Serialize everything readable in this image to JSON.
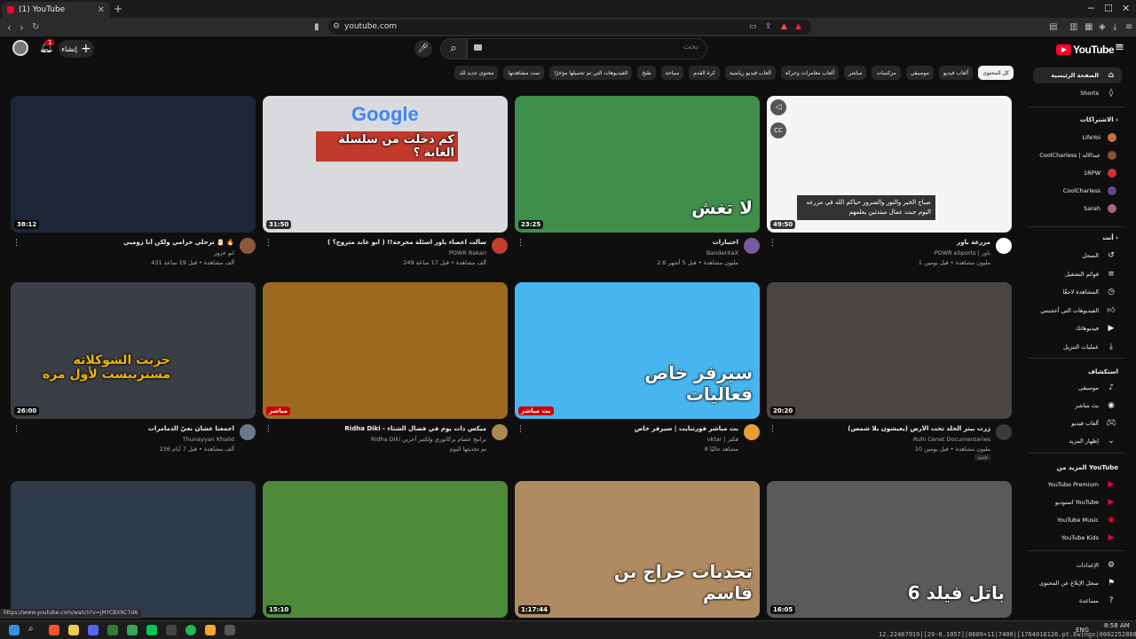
{
  "browser": {
    "tab_title": "(1) YouTube",
    "url": "youtube.com",
    "status_url": "https://www.youtube.com/watch?v=jMYCBXRC7dA"
  },
  "header": {
    "notification_count": "1",
    "create_label": "إنشاء",
    "search_placeholder": "بحث",
    "logo_text": "YouTube",
    "logo_country": "SA"
  },
  "chips": [
    "كل المحتوى",
    "ألعاب فيديو",
    "موسيقى",
    "مزكسات",
    "مباشر",
    "ألعاب مغامرات وحركة",
    "ألعاب فيديو رياضية",
    "كرة القدم",
    "سياحة",
    "طبخ",
    "الفيديوهات التي تم تحميلها مؤخرًا",
    "تمت مشاهدتها",
    "محتوى جديد لك"
  ],
  "videos": [
    {
      "title": "ترحلي حرامي ولكن أنا زوميي 🎅 🔥",
      "channel": "ابو عزوز",
      "stats": "431 ألف مشاهدة • قبل 19 ساعة",
      "duration": "38:12",
      "overlay": "",
      "thumb_color": "#1d2636"
    },
    {
      "title": "سألت اعضاء باور اسئلة محرجة!! ( ابو عابد متزوج؟ )",
      "channel": "POWR Rakan",
      "stats": "249 ألف مشاهدة • قبل 17 ساعة",
      "duration": "31:50",
      "overlay": "كم دخلت من سلسلة الغابة ؟",
      "thumb_color": "#d8dadd"
    },
    {
      "title": "اختبارات",
      "channel": "BanderitaX",
      "stats": "2.6 مليون مشاهدة • قبل 5 أشهر",
      "duration": "23:25",
      "overlay": "لا تغش",
      "thumb_color": "#3f8f4a"
    },
    {
      "title": "مزرعة باور",
      "channel": "POWR eSports | باور",
      "stats": "1 مليون مشاهدة • قبل يومين",
      "duration": "49:50",
      "overlay": "صباح الخير والنور والسرور حياكم الله في مزرعه اليوم جبت عمال مبتدئين يعلمهم",
      "thumb_color": "#f5f5f5"
    },
    {
      "title": "اجمعنا عشان نعيّ الدمامرات",
      "channel": "Thunayyan Khalid",
      "stats": "236 ألف مشاهدة • قبل 7 أيام",
      "duration": "26:00",
      "overlay": "جربت الشوكلاته مستربيست لأول مره",
      "thumb_color": "#3a3f45"
    },
    {
      "title": "Ridha Diki - ميكس ذات يوم في فضال الشتاء",
      "channel": "Ridha Diki برامج عصام يركانوري ولكثير آخرين",
      "stats": "تم تحديثها اليوم",
      "duration": "",
      "overlay": "",
      "thumb_color": "#9b6a1f"
    },
    {
      "title": "بث مباشر فورتنايت | سيرفر خاص",
      "channel": "vktar | فكتر",
      "stats": "8 مشاهد حاليًا",
      "duration": "",
      "overlay": "سيرفر خاص فعاليات",
      "thumb_color": "#48b6ee"
    },
    {
      "title": "زرت بيتر الخلد تحت الأرض (يعيشون بلا شمس)",
      "channel": "Ruhi Cenet Documentaries",
      "stats": "10 مليون مشاهدة • قبل يومين",
      "duration": "20:20",
      "overlay": "",
      "thumb_color": "#4a4540"
    },
    {
      "title": "",
      "channel": "",
      "stats": "",
      "duration": "",
      "overlay": "",
      "thumb_color": "#2f3a4a"
    },
    {
      "title": "",
      "channel": "",
      "stats": "",
      "duration": "15:10",
      "overlay": "",
      "thumb_color": "#4e8a3a"
    },
    {
      "title": "",
      "channel": "",
      "stats": "",
      "duration": "1:17:44",
      "overlay": "تحديات حراج بن قاسم",
      "thumb_color": "#b08a60"
    },
    {
      "title": "",
      "channel": "",
      "stats": "",
      "duration": "16:05",
      "overlay": "باتل فيلد 6",
      "thumb_color": "#5a5a5a"
    }
  ],
  "video_badges": {
    "live": "بث مباشر",
    "live_alt": "مباشر",
    "new": "جديد"
  },
  "sidebar": {
    "home": "الصفحة الرئيسية",
    "shorts": "Shorts",
    "subscriptions_head": "الاشتراكات",
    "subs": [
      "LifeYoi",
      "CoolCharless | عبدالاله",
      "1RPW",
      "CoolCharless",
      "Sarah"
    ],
    "you_head": "أنت",
    "you_items": [
      "السجل",
      "قوائم التشغيل",
      "المشاهدة لاحقًا",
      "الفيديوهات التي أعجبتني",
      "فيديوهاتك",
      "عمليات التنزيل"
    ],
    "explore_head": "استكشاف",
    "explore_items": [
      "موسيقى",
      "بث مباشر",
      "ألعاب فيديو",
      "إظهار المزيد"
    ],
    "more_head": "المزيد من YouTube",
    "more_items": [
      "YouTube Premium",
      "استوديو YouTube",
      "YouTube Music",
      "YouTube Kids"
    ],
    "settings_items": [
      "الإعدادات",
      "سجل الإبلاغ عن المحتوى",
      "مساعدة"
    ]
  },
  "taskbar": {
    "lang": "ENG",
    "time": "8:58 AM",
    "date": "11/6/2025"
  },
  "debug_overlay": "12.22467919|[29-0.1057]|0689+11|7400|[1764018126.pt.Ewingx|0002252808]"
}
